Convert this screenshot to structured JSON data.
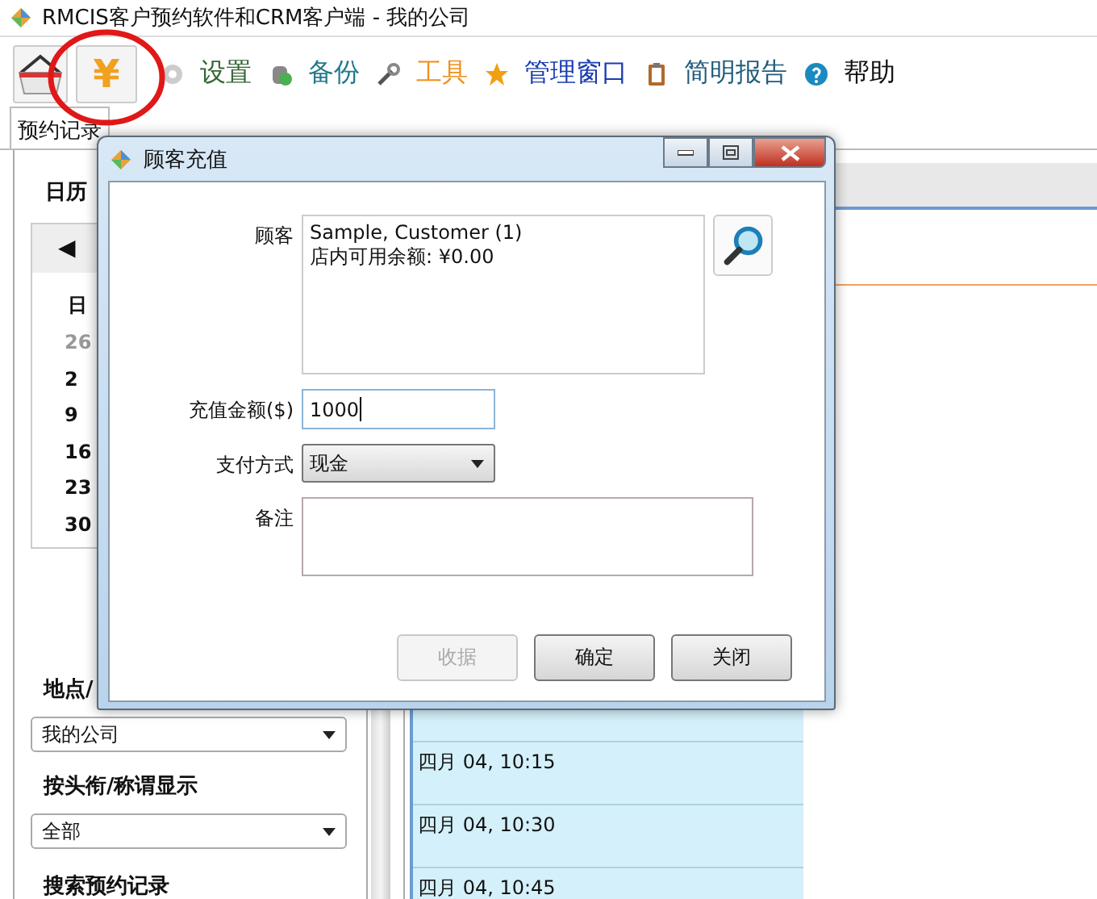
{
  "window": {
    "title": "RMCIS客户预约软件和CRM客户端 - 我的公司"
  },
  "toolbar": {
    "yen_button": {
      "symbol": "¥"
    },
    "menu": [
      {
        "label": "设置",
        "kind": "gear",
        "color": "#336633"
      },
      {
        "label": "备份",
        "kind": "database",
        "color": "#1f7a8c"
      },
      {
        "label": "工具",
        "kind": "wrench",
        "color": "#f0901c"
      },
      {
        "label": "管理窗口",
        "kind": "star",
        "color": "#1a3cb0"
      },
      {
        "label": "简明报告",
        "kind": "clipboard",
        "color": "#1f5b7a"
      },
      {
        "label": "帮助",
        "kind": "help",
        "color": "#111111"
      }
    ]
  },
  "tabs": [
    {
      "label": "预约记录",
      "selected": true
    }
  ],
  "sidebar": {
    "calendar": {
      "title": "日历",
      "nav": "◀",
      "weekday": "日",
      "days": [
        {
          "label": "26",
          "other_month": true
        },
        {
          "label": "2",
          "other_month": false
        },
        {
          "label": "9",
          "other_month": false
        },
        {
          "label": "16",
          "other_month": false
        },
        {
          "label": "23",
          "other_month": false
        },
        {
          "label": "30",
          "other_month": false
        }
      ]
    },
    "filters": [
      {
        "label": "地点/",
        "value": "我的公司"
      },
      {
        "label": "按头衔/称谓显示",
        "value": "全部"
      }
    ],
    "search_heading": "搜索预约记录"
  },
  "schedule": {
    "slots": [
      "四月 04, 10:15",
      "四月 04, 10:30",
      "四月 04, 10:45"
    ]
  },
  "dialog": {
    "title": "顾客充值",
    "customer_label": "顾客",
    "customer_lines": [
      "Sample, Customer (1)",
      "店内可用余额: ¥0.00"
    ],
    "amount_label": "充值金额($)",
    "amount": "1000",
    "payment_label": "支付方式",
    "payment": "现金",
    "notes_label": "备注",
    "buttons": [
      {
        "label": "收据",
        "disabled": true
      },
      {
        "label": "确定",
        "disabled": false
      },
      {
        "label": "关闭",
        "disabled": false
      }
    ]
  }
}
